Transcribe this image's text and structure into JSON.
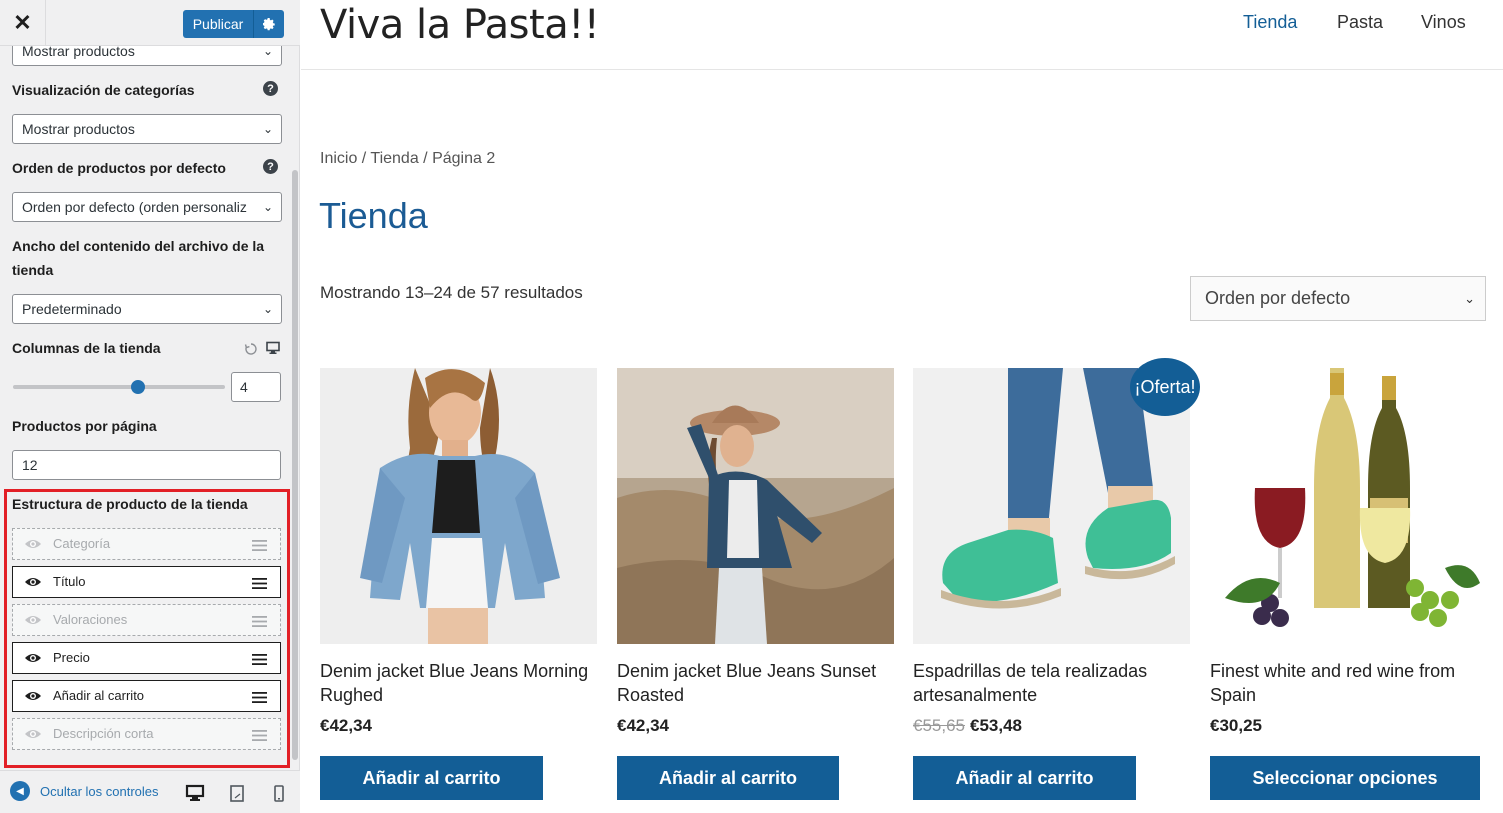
{
  "sidebar": {
    "close_symbol": "✕",
    "publish_label": "Publicar",
    "publish_settings_icon": "gear-icon",
    "top_select_value": "Mostrar productos",
    "category_display": {
      "label": "Visualización de categorías",
      "value": "Mostrar productos"
    },
    "default_order": {
      "label": "Orden de productos por defecto",
      "value": "Orden por defecto (orden personaliz"
    },
    "archive_width": {
      "label_line1": "Ancho del contenido del archivo de la",
      "label_line2": "tienda",
      "value": "Predeterminado"
    },
    "shop_columns": {
      "label": "Columnas de la tienda",
      "value": "4",
      "slider_fraction": 0.6
    },
    "products_per_page": {
      "label": "Productos por página",
      "value": "12"
    },
    "product_structure": {
      "label": "Estructura de producto de la tienda",
      "items": [
        {
          "label": "Categoría",
          "visible": false
        },
        {
          "label": "Título",
          "visible": true
        },
        {
          "label": "Valoraciones",
          "visible": false
        },
        {
          "label": "Precio",
          "visible": true
        },
        {
          "label": "Añadir al carrito",
          "visible": true
        },
        {
          "label": "Descripción corta",
          "visible": false
        }
      ]
    },
    "footer": {
      "hide_controls": "Ocultar los controles"
    },
    "help_symbol": "?"
  },
  "site": {
    "title": "Viva la Pasta!!",
    "nav": [
      "Tienda",
      "Pasta",
      "Vinos"
    ],
    "breadcrumb": "Inicio / Tienda / Página 2",
    "page_title": "Tienda",
    "result_count": "Mostrando 13–24 de 57 resultados",
    "order_by": "Orden por defecto",
    "accent_color": "#135e96"
  },
  "products": [
    {
      "name": "Denim jacket Blue Jeans Morning Rughed",
      "price": "€42,34",
      "old_price": "",
      "button": "Añadir al carrito"
    },
    {
      "name": "Denim jacket Blue Jeans Sunset Roasted",
      "price": "€42,34",
      "old_price": "",
      "button": "Añadir al carrito"
    },
    {
      "name": "Espadrillas de tela realizadas artesanalmente",
      "price": "€53,48",
      "old_price": "€55,65",
      "button": "Añadir al carrito",
      "badge": "¡Oferta!"
    },
    {
      "name": "Finest white and red wine from Spain",
      "price": "€30,25",
      "old_price": "",
      "button": "Seleccionar opciones"
    }
  ]
}
